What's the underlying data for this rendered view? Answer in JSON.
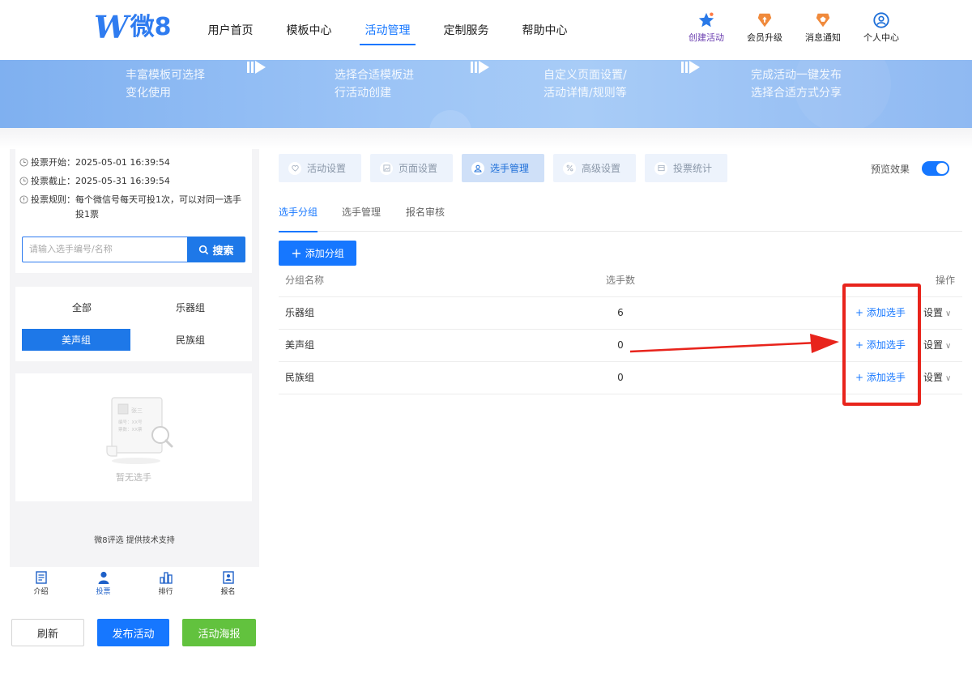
{
  "logo": {
    "letter": "W",
    "text": "微8"
  },
  "nav": {
    "items": [
      {
        "label": "用户首页",
        "active": false
      },
      {
        "label": "模板中心",
        "active": false
      },
      {
        "label": "活动管理",
        "active": true
      },
      {
        "label": "定制服务",
        "active": false
      },
      {
        "label": "帮助中心",
        "active": false
      }
    ]
  },
  "tools": [
    {
      "label": "创建活动",
      "icon": "star-icon"
    },
    {
      "label": "会员升级",
      "icon": "upgrade-icon"
    },
    {
      "label": "消息通知",
      "icon": "notification-icon"
    },
    {
      "label": "个人中心",
      "icon": "user-icon"
    }
  ],
  "banner": {
    "steps": [
      [
        "丰富模板可选择",
        "变化使用"
      ],
      [
        "选择合适模板进",
        "行活动创建"
      ],
      [
        "自定义页面设置/",
        "活动详情/规则等"
      ],
      [
        "完成活动一键发布",
        "选择合适方式分享"
      ]
    ]
  },
  "preview": {
    "vote_start": "投票开始：2025-05-01 16:39:54",
    "vote_end": "投票截止：2025-05-31 16:39:54",
    "rule_line1": "投票规则：每个微信号每天可投1次，可以对同一选手",
    "rule_line2": "投1票",
    "search_placeholder": "请输入选手编号/名称",
    "search_button": "搜索",
    "groups": [
      {
        "label": "全部",
        "selected": false
      },
      {
        "label": "乐器组",
        "selected": false
      },
      {
        "label": "美声组",
        "selected": true
      },
      {
        "label": "民族组",
        "selected": false
      }
    ],
    "empty_card": {
      "name": "张三",
      "code": "编号：XX号",
      "votes": "票数：XX票"
    },
    "empty_text": "暂无选手",
    "support": "微8评选 提供技术支持",
    "tabbar": [
      {
        "label": "介绍",
        "icon": "document-icon"
      },
      {
        "label": "投票",
        "icon": "person-icon"
      },
      {
        "label": "排行",
        "icon": "ranking-icon"
      },
      {
        "label": "报名",
        "icon": "badge-icon"
      }
    ]
  },
  "actions": {
    "refresh": "刷新",
    "publish": "发布活动",
    "poster": "活动海报"
  },
  "function_tabs": [
    {
      "label": "活动设置",
      "icon": "heart-icon",
      "active": false
    },
    {
      "label": "页面设置",
      "icon": "image-icon",
      "active": false
    },
    {
      "label": "选手管理",
      "icon": "player-icon",
      "active": true
    },
    {
      "label": "高级设置",
      "icon": "percent-icon",
      "active": false
    },
    {
      "label": "投票统计",
      "icon": "stats-icon",
      "active": false
    }
  ],
  "preview_toggle": {
    "label": "预览效果",
    "on": true
  },
  "sub_tabs": [
    {
      "label": "选手分组",
      "active": true
    },
    {
      "label": "选手管理",
      "active": false
    },
    {
      "label": "报名审核",
      "active": false
    }
  ],
  "add_group_button": "添加分组",
  "table": {
    "headers": {
      "name": "分组名称",
      "count": "选手数",
      "ops": "操作"
    },
    "rows": [
      {
        "name": "乐器组",
        "count": "6",
        "add": "添加选手",
        "settings": "设置"
      },
      {
        "name": "美声组",
        "count": "0",
        "add": "添加选手",
        "settings": "设置"
      },
      {
        "name": "民族组",
        "count": "0",
        "add": "添加选手",
        "settings": "设置"
      }
    ]
  },
  "colors": {
    "primary": "#1677ff",
    "annotation": "#e8241c",
    "poster": "#62c23e"
  }
}
